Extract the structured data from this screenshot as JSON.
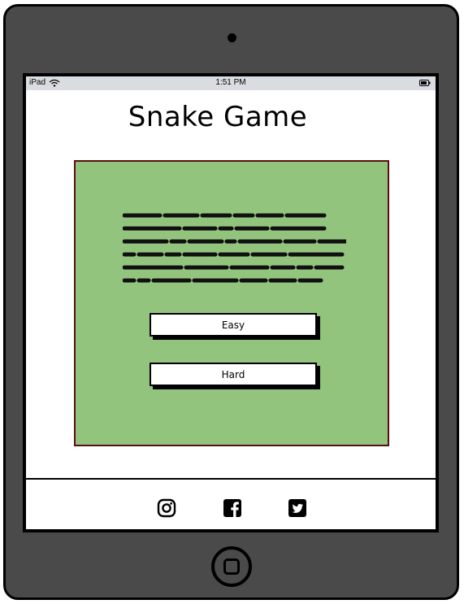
{
  "statusbar": {
    "carrier": "iPad",
    "time": "1:51 PM"
  },
  "page": {
    "title": "Snake Game"
  },
  "menu": {
    "easy_label": "Easy",
    "hard_label": "Hard"
  },
  "footer": {
    "icons": [
      "instagram-icon",
      "facebook-icon",
      "twitter-icon"
    ]
  },
  "colors": {
    "device": "#4a4a4a",
    "panel": "#93c47d",
    "panel_border": "#5a0e0e",
    "statusbar": "#d9dde1"
  }
}
